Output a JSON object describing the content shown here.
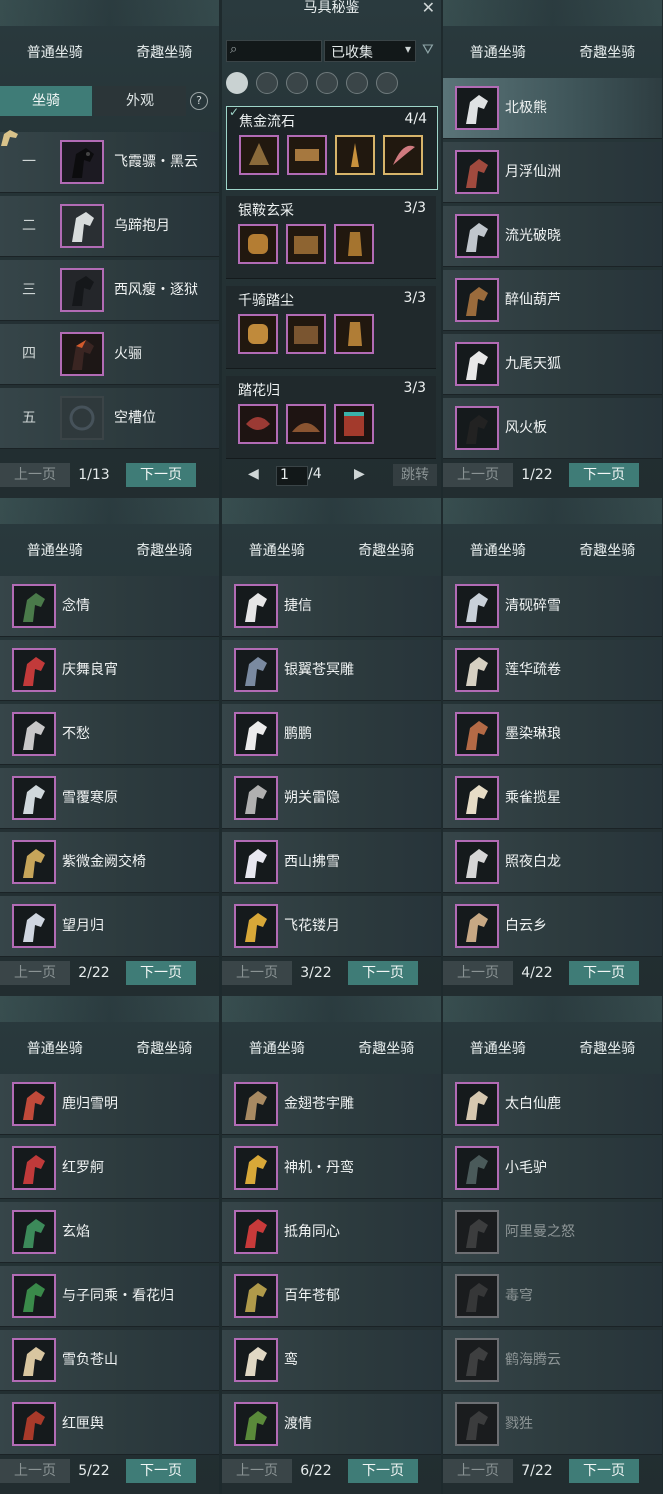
{
  "common": {
    "tab_normal": "普通坐骑",
    "tab_fun": "奇趣坐骑",
    "prev": "上一页",
    "next": "下一页"
  },
  "panel_main": {
    "subtab_mount": "坐骑",
    "subtab_look": "外观",
    "help": "?",
    "rows": [
      {
        "num": "一",
        "label": "飞霞骠・黑云"
      },
      {
        "num": "二",
        "label": "乌蹄抱月"
      },
      {
        "num": "三",
        "label": "西风瘦・逐狱"
      },
      {
        "num": "四",
        "label": "火骊"
      },
      {
        "num": "五",
        "label": "空槽位"
      }
    ],
    "page": "1/13"
  },
  "panel_mid": {
    "title": "马具秘鉴",
    "close": "✕",
    "search_placeholder": "",
    "filter_value": "已收集",
    "sets": [
      {
        "name": "焦金流石",
        "count": "4/4"
      },
      {
        "name": "银鞍玄采",
        "count": "3/3"
      },
      {
        "name": "千骑踏尘",
        "count": "3/3"
      },
      {
        "name": "踏花归",
        "count": "3/3"
      }
    ],
    "page_input": "1",
    "page_total": "/4",
    "jump": "跳转"
  },
  "panels": [
    {
      "page": "1/22",
      "rows": [
        "北极熊",
        "月浮仙洲",
        "流光破晓",
        "醉仙葫芦",
        "九尾天狐",
        "风火板"
      ]
    },
    {
      "page": "2/22",
      "rows": [
        "念情",
        "庆舞良宵",
        "不愁",
        "雪覆寒原",
        "紫微金阙交椅",
        "望月归"
      ]
    },
    {
      "page": "3/22",
      "rows": [
        "捷信",
        "银翼苍冥雕",
        "鹏鹏",
        "朔关雷隐",
        "西山拂雪",
        "飞花镂月"
      ]
    },
    {
      "page": "4/22",
      "rows": [
        "清砚碎雪",
        "莲华疏卷",
        "墨染琳琅",
        "乘雀揽星",
        "照夜白龙",
        "白云乡"
      ]
    },
    {
      "page": "5/22",
      "rows": [
        "鹿归雪明",
        "红罗舸",
        "玄焰",
        "与子同乘・看花归",
        "雪负苍山",
        "红匣舆"
      ]
    },
    {
      "page": "6/22",
      "rows": [
        "金翅苍宇雕",
        "神机・丹鸾",
        "抵角同心",
        "百年苍郁",
        "鸾",
        "渡情"
      ]
    },
    {
      "page": "7/22",
      "rows": [
        "太白仙鹿",
        "小毛驴",
        "阿里曼之怒",
        "毒穹",
        "鹤海腾云",
        "戮狌"
      ]
    }
  ],
  "colors": {
    "accent": "#3f7c77",
    "frame_purple": "#b26bb5",
    "frame_grey": "#6d6f73"
  }
}
